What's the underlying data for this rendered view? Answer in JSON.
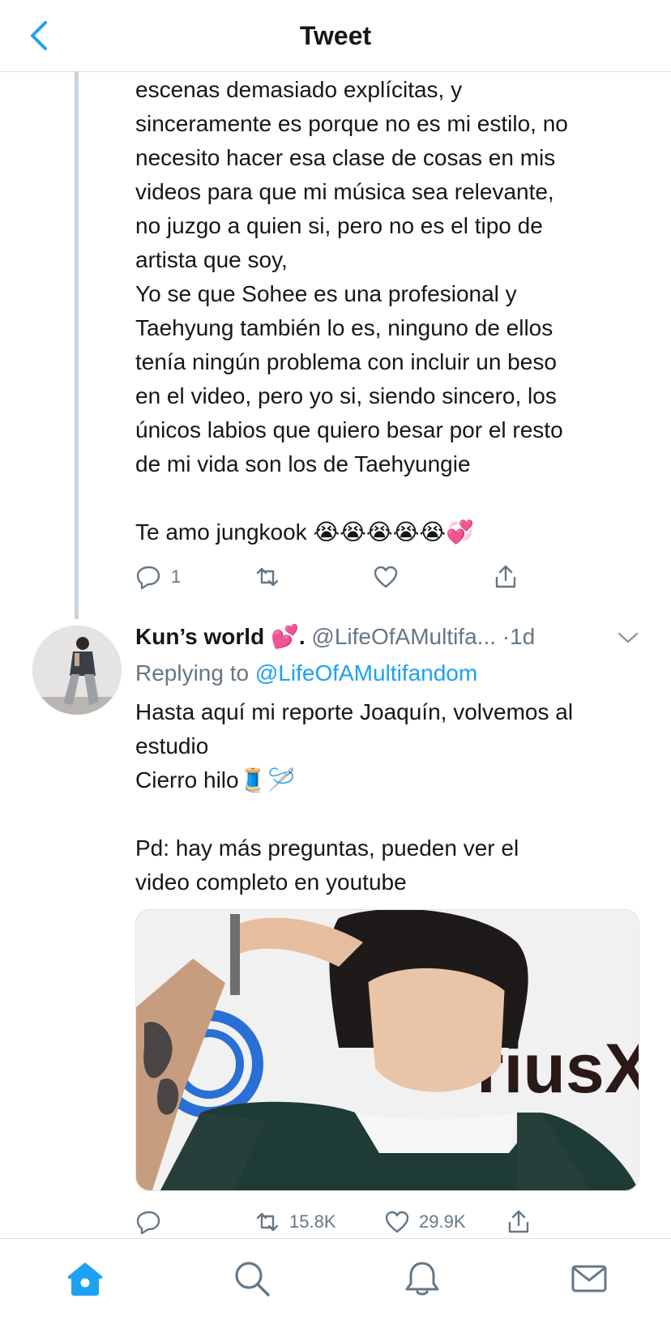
{
  "header": {
    "title": "Tweet"
  },
  "tweet1": {
    "text": "escenas demasiado explícitas, y\nsinceramente es porque no es mi estilo, no\nnecesito hacer esa clase de cosas en mis\nvideos para que mi música sea relevante,\nno juzgo a quien si, pero no es el tipo de\nartista que soy,\nYo se que Sohee es una profesional y\nTaehyung también lo es, ninguno de ellos\ntenía ningún problema con incluir un beso\nen el video, pero yo si, siendo sincero, los\núnicos labios que quiero besar por el resto\nde mi vida son los de Taehyungie\n\nTe amo jungkook 😭😭😭😭😭💞",
    "reply_count": "1",
    "retweet_count": "",
    "like_count": ""
  },
  "tweet2": {
    "name": "Kun’s world 💕.",
    "handle": "@LifeOfAMultifa...",
    "time": "·1d",
    "replying_prefix": "Replying to",
    "replying_handle": "@LifeOfAMultifandom",
    "text": "Hasta aquí mi reporte Joaquín, volvemos al\nestudio\nCierro hilo🧵🪡\n\nPd: hay más preguntas, pueden ver el\nvideo completo en youtube",
    "media_text": "riusX",
    "reply_count": "",
    "retweet_count": "15.8K",
    "like_count": "29.9K"
  },
  "icons": {
    "back": "chevron-left-icon",
    "reply": "reply-icon",
    "retweet": "retweet-icon",
    "like": "heart-icon",
    "share": "share-icon",
    "home": "home-icon",
    "search": "search-icon",
    "notifications": "bell-icon",
    "messages": "mail-icon"
  },
  "colors": {
    "accent": "#1da1f2",
    "text": "#14171a",
    "secondary": "#657786",
    "divider": "#dfe3e6"
  }
}
